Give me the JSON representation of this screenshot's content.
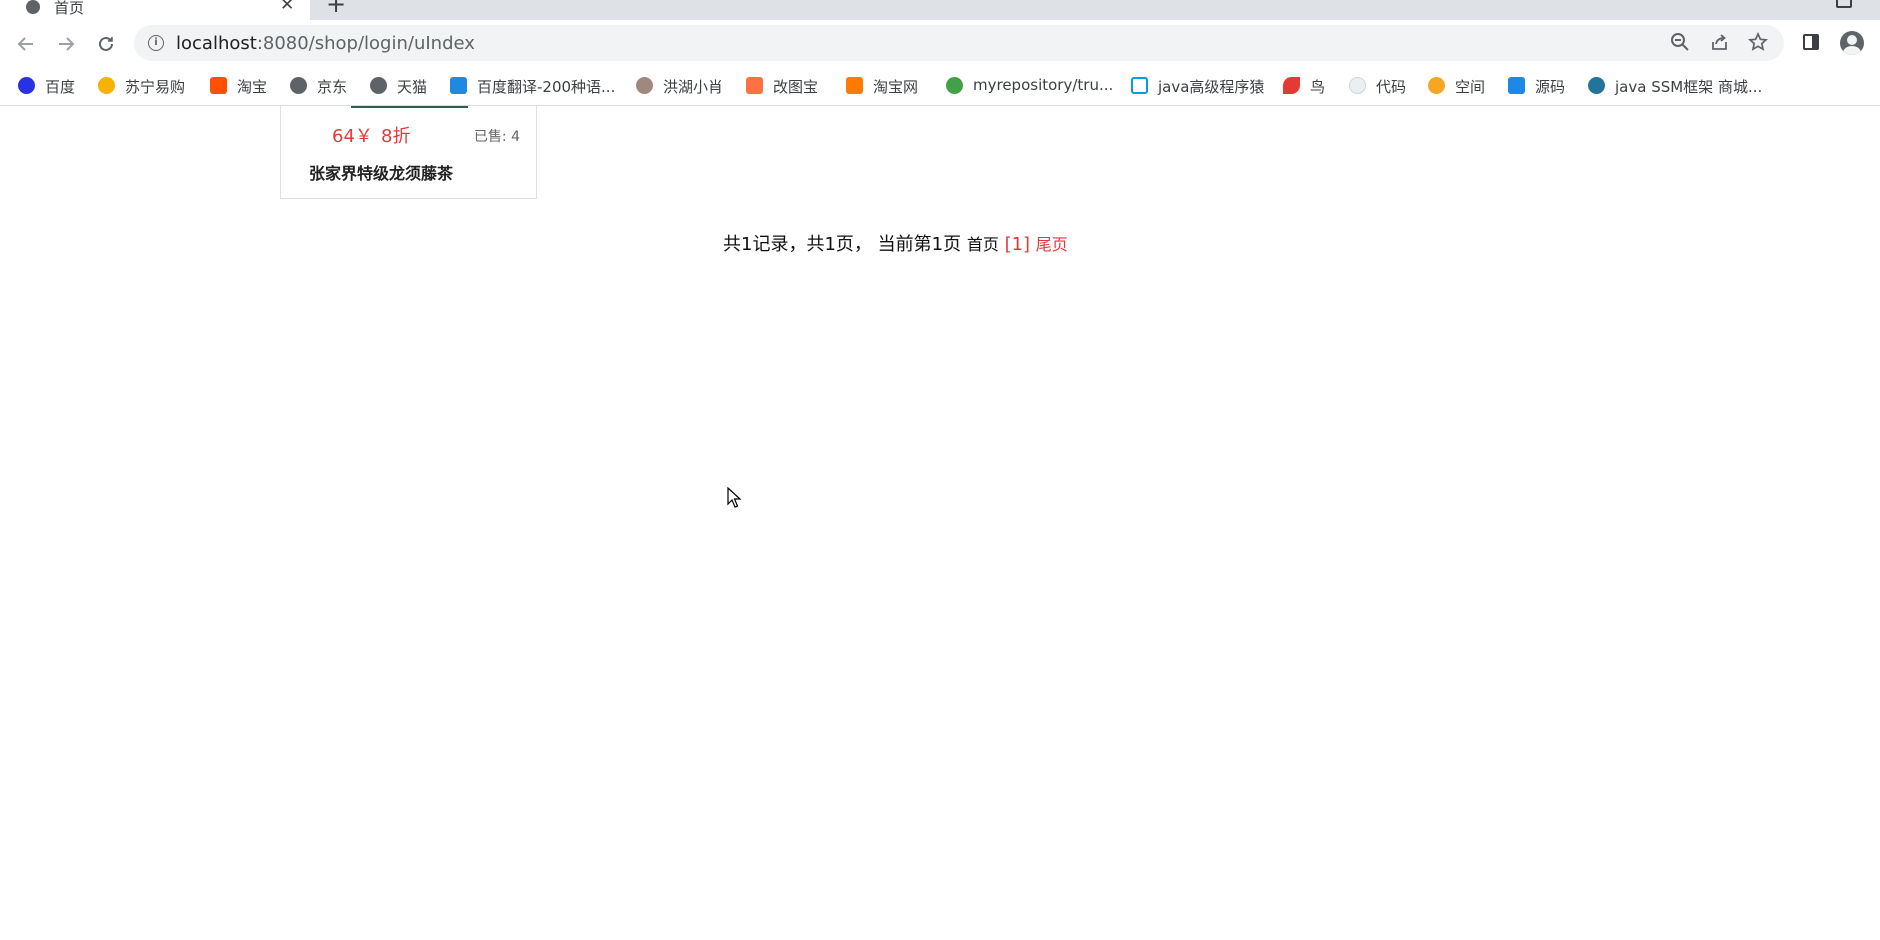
{
  "browser": {
    "tab": {
      "title": "首页",
      "close": "✕"
    },
    "new_tab": "+",
    "address": {
      "host": "localhost",
      "rest": ":8080/shop/login/uIndex"
    }
  },
  "bookmarks": [
    {
      "label": "百度",
      "icon": "baidu-icon",
      "color": "#2932e1"
    },
    {
      "label": "苏宁易购",
      "icon": "suning-icon",
      "color": "#f7b100"
    },
    {
      "label": "淘宝",
      "icon": "taobao-icon",
      "color": "#ff5000"
    },
    {
      "label": "京东",
      "icon": "globe-icon",
      "color": "#5f6368"
    },
    {
      "label": "天猫",
      "icon": "globe-icon",
      "color": "#5f6368"
    },
    {
      "label": "百度翻译-200种语...",
      "icon": "translate-icon",
      "color": "#1e88e5"
    },
    {
      "label": "洪湖小肖",
      "icon": "eagle-icon",
      "color": "#8d6e63"
    },
    {
      "label": "改图宝",
      "icon": "gaitubao-icon",
      "color": "#ff7043"
    },
    {
      "label": "淘宝网",
      "icon": "taobao-icon",
      "color": "#ff7a00"
    },
    {
      "label": "myrepository/tru...",
      "icon": "repo-icon",
      "color": "#43a047"
    },
    {
      "label": "java高级程序猿",
      "icon": "bilibili-icon",
      "color": "#00a1d6"
    },
    {
      "label": "鸟",
      "icon": "bird-icon",
      "color": "#e53935"
    },
    {
      "label": "代码",
      "icon": "code-icon",
      "color": "#cfd8dc"
    },
    {
      "label": "空间",
      "icon": "qzone-icon",
      "color": "#f5a623"
    },
    {
      "label": "源码",
      "icon": "docker-icon",
      "color": "#1e88e5"
    },
    {
      "label": "java SSM框架 商城...",
      "icon": "wordpress-icon",
      "color": "#21759b"
    }
  ],
  "product": {
    "price": "64￥",
    "discount": "8折",
    "sold": "已售: 4",
    "name": "张家界特级龙须藤茶"
  },
  "pagination": {
    "summary": "共1记录，共1页， 当前第1页 ",
    "first": "首页",
    "current": "[1]",
    "last": "尾页"
  }
}
